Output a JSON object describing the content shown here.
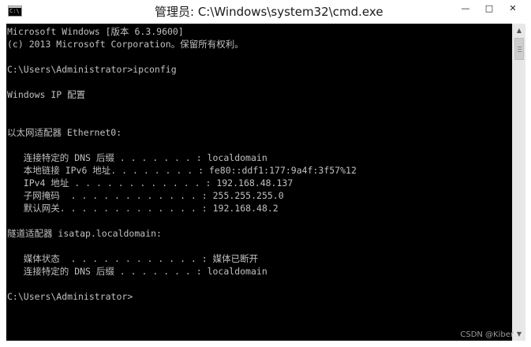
{
  "window": {
    "icon_text": "C:\\",
    "title": "管理员: C:\\Windows\\system32\\cmd.exe",
    "controls": {
      "minimize": "—",
      "maximize": "□",
      "close": "✕"
    }
  },
  "console": {
    "lines": [
      "Microsoft Windows [版本 6.3.9600]",
      "(c) 2013 Microsoft Corporation。保留所有权利。",
      "",
      "C:\\Users\\Administrator>ipconfig",
      "",
      "Windows IP 配置",
      "",
      "",
      "以太网适配器 Ethernet0:",
      "",
      "   连接特定的 DNS 后缀 . . . . . . . : localdomain",
      "   本地链接 IPv6 地址. . . . . . . . : fe80::ddf1:177:9a4f:3f57%12",
      "   IPv4 地址 . . . . . . . . . . . . : 192.168.48.137",
      "   子网掩码  . . . . . . . . . . . . : 255.255.255.0",
      "   默认网关. . . . . . . . . . . . . : 192.168.48.2",
      "",
      "隧道适配器 isatap.localdomain:",
      "",
      "   媒体状态  . . . . . . . . . . . . : 媒体已断开",
      "   连接特定的 DNS 后缀 . . . . . . . : localdomain",
      "",
      "C:\\Users\\Administrator>"
    ]
  },
  "scrollbar": {
    "up_arrow": "▲",
    "down_arrow": "▼"
  },
  "watermark": "CSDN @Kiber"
}
